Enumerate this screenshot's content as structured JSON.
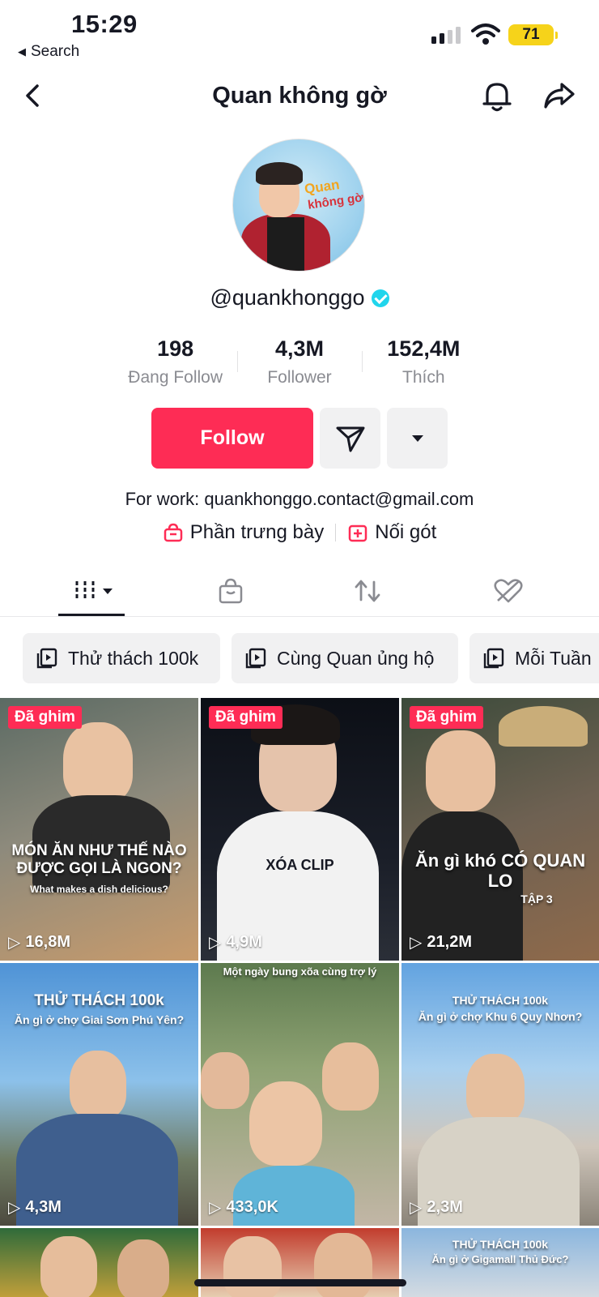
{
  "status": {
    "time": "15:29",
    "back_label": "Search",
    "battery": "71"
  },
  "nav": {
    "title": "Quan không gờ"
  },
  "profile": {
    "handle": "@quankhonggo",
    "stats": [
      {
        "value": "198",
        "label": "Đang Follow"
      },
      {
        "value": "4,3M",
        "label": "Follower"
      },
      {
        "value": "152,4M",
        "label": "Thích"
      }
    ],
    "follow_label": "Follow",
    "bio": "For work: quankhonggo.contact@gmail.com",
    "links": [
      {
        "label": "Phần trưng bày",
        "icon": "shopping-bag-icon"
      },
      {
        "label": "Nối gót",
        "icon": "add-box-icon"
      }
    ],
    "avatar_text": [
      "Quan",
      "không gờ"
    ]
  },
  "tabs": [
    {
      "name": "videos-tab",
      "icon": "grid-bars-icon"
    },
    {
      "name": "shop-tab",
      "icon": "shopping-bag-icon"
    },
    {
      "name": "reposts-tab",
      "icon": "repost-icon"
    },
    {
      "name": "liked-tab",
      "icon": "hidden-heart-icon"
    }
  ],
  "playlists": [
    {
      "label": "Thử thách 100k"
    },
    {
      "label": "Cùng Quan ủng hộ"
    },
    {
      "label": "Mỗi Tuần"
    }
  ],
  "videos": [
    {
      "pinned": "Đã ghim",
      "views": "16,8M",
      "caption": "MÓN ĂN NHƯ THẾ NÀO ĐƯỢC GỌI LÀ NGON?",
      "subcaption": "What makes a dish delicious?"
    },
    {
      "pinned": "Đã ghim",
      "views": "4,9M",
      "caption": "XÓA CLIP",
      "subcaption": ""
    },
    {
      "pinned": "Đã ghim",
      "views": "21,2M",
      "caption": "Ăn gì khó CÓ QUAN LO",
      "subcaption": "TẬP 3"
    },
    {
      "pinned": "",
      "views": "4,3M",
      "caption": "THỬ THÁCH 100k",
      "subcaption": "Ăn gì ở chợ Giai Sơn Phú Yên?"
    },
    {
      "pinned": "",
      "views": "433,0K",
      "caption": "Một ngày bung xõa cùng trợ lý",
      "subcaption": ""
    },
    {
      "pinned": "",
      "views": "2,3M",
      "caption": "THỬ THÁCH 100k",
      "subcaption": "Ăn gì ở chợ Khu 6 Quy Nhơn?"
    },
    {
      "pinned": "",
      "views": "",
      "caption": "",
      "subcaption": ""
    },
    {
      "pinned": "",
      "views": "",
      "caption": "",
      "subcaption": ""
    },
    {
      "pinned": "",
      "views": "",
      "caption": "THỬ THÁCH 100k",
      "subcaption": "Ăn gì ở Gigamall Thủ Đức?"
    }
  ],
  "colors": {
    "accent": "#fe2c55",
    "verified": "#20d5ec",
    "battery": "#f6d31a"
  }
}
